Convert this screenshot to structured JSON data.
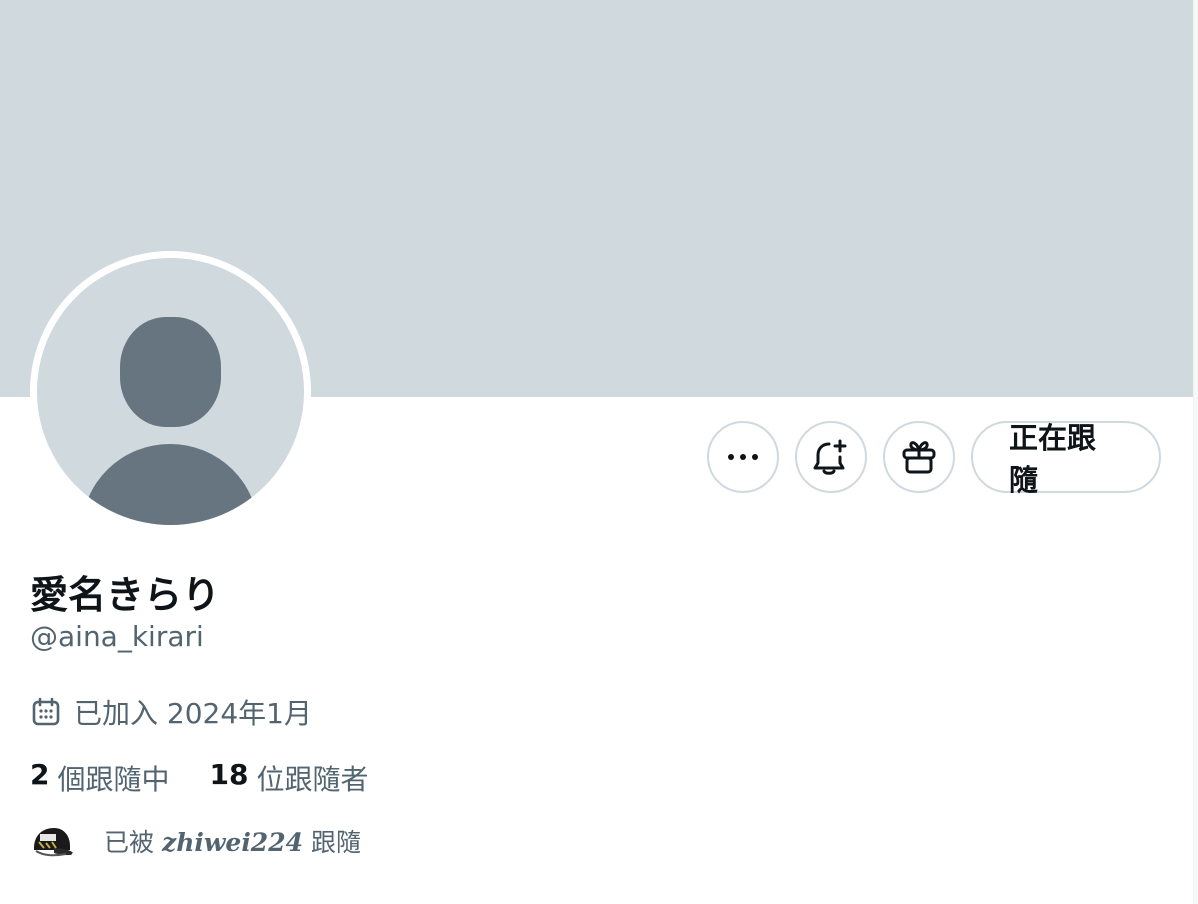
{
  "profile": {
    "display_name": "愛名きらり",
    "handle": "@aina_kirari",
    "joined": "已加入 2024年1月",
    "following_count": "2",
    "following_label": "個跟隨中",
    "followers_count": "18",
    "followers_label": "位跟隨者",
    "followed_by_prefix": "已被",
    "followed_by_name": "zhiwei224",
    "followed_by_suffix": "跟隨"
  },
  "actions": {
    "more_icon": "more-horizontal-icon",
    "notify_icon": "bell-plus-icon",
    "gift_icon": "gift-icon",
    "follow_label": "正在跟隨"
  },
  "colors": {
    "banner": "#cfd9de",
    "avatar_placeholder_bg": "#cfd9de",
    "avatar_placeholder_fg": "#66757f",
    "secondary_text": "#536471",
    "primary_text": "#0f1419",
    "button_border": "#cfd9de"
  }
}
